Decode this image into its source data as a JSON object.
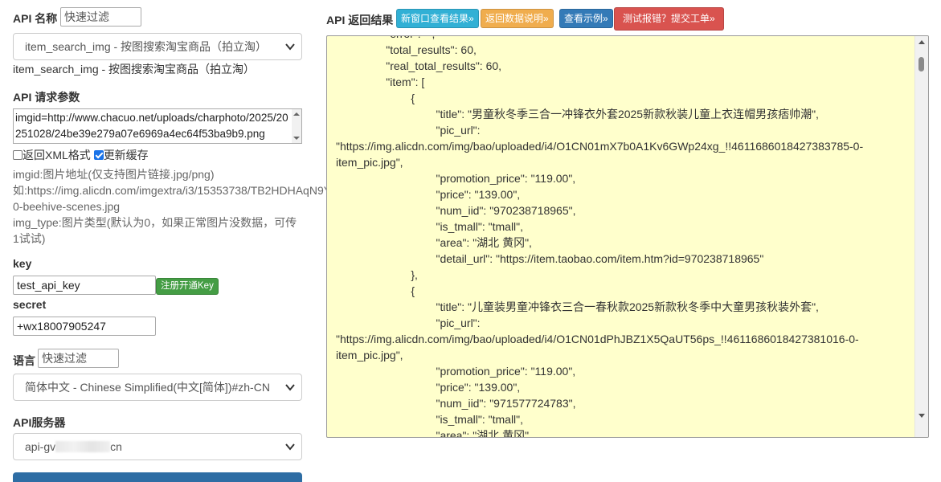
{
  "left": {
    "api_name_label": "API 名称",
    "api_filter_placeholder": "快速过滤",
    "api_select_value": "item_search_img - 按图搜索淘宝商品（拍立淘）",
    "api_desc": "item_search_img - 按图搜索淘宝商品（拍立淘）",
    "params_label": "API 请求参数",
    "params_value": "imgid=http://www.chacuo.net/uploads/charphoto/2025/20251028/24be39e279a07e6969a4ec64f53ba9b9.png",
    "xml_label": "返回XML格式",
    "cache_label": "更新缓存",
    "help_lines": [
      "imgid:图片地址(仅支持图片链接.jpg/png)",
      "如:https://img.alicdn.com/imgextra/i3/15353738/TB2HDHAqN9Y",
      "0-beehive-scenes.jpg",
      "img_type:图片类型(默认为0，如果正常图片没数据，可传",
      "1试试)"
    ],
    "key_label": "key",
    "key_value": "test_api_key",
    "register_key_label": "注册开通Key",
    "secret_label": "secret",
    "secret_value": "+wx18007905247",
    "lang_label": "语言",
    "lang_filter_placeholder": "快速过滤",
    "lang_select_value": "简体中文 - Chinese Simplified(中文[简体])#zh-CN",
    "server_label": "API服务器",
    "server_prefix": "api-gv",
    "server_suffix": "cn"
  },
  "right": {
    "result_label": "API 返回结果",
    "btn_new_window": "新窗口查看结果»",
    "btn_return_desc": "返回数据说明»",
    "btn_example": "查看示例»",
    "btn_report": "测试报错？提交工单»",
    "result_text": "                \"error\": \"\",\n                \"total_results\": 60,\n                \"real_total_results\": 60,\n                \"item\": [\n                        {\n                                \"title\": \"男童秋冬季三合一冲锋衣外套2025新款秋装儿童上衣连帽男孩痞帅潮\",\n                                \"pic_url\": \"https://img.alicdn.com/img/bao/uploaded/i4/O1CN01mX7b0A1Kv6GWp24xg_!!4611686018427383785-0-item_pic.jpg\",\n                                \"promotion_price\": \"119.00\",\n                                \"price\": \"139.00\",\n                                \"num_iid\": \"970238718965\",\n                                \"is_tmall\": \"tmall\",\n                                \"area\": \"湖北 黄冈\",\n                                \"detail_url\": \"https://item.taobao.com/item.htm?id=970238718965\"\n                        },\n                        {\n                                \"title\": \"儿童装男童冲锋衣三合一春秋款2025新款秋冬季中大童男孩秋装外套\",\n                                \"pic_url\": \"https://img.alicdn.com/img/bao/uploaded/i4/O1CN01dPhJBZ1X5QaUT56ps_!!4611686018427381016-0-item_pic.jpg\",\n                                \"promotion_price\": \"119.00\",\n                                \"price\": \"139.00\",\n                                \"num_iid\": \"971577724783\",\n                                \"is_tmall\": \"tmall\",\n                                \"area\": \"湖北 黄冈\","
  },
  "colors": {
    "btn_cyan": "#31b0d5",
    "btn_orange": "#f0ad4e",
    "btn_blue": "#337ab7",
    "btn_red": "#d9534f",
    "btn_green": "#449d44",
    "result_bg": "#ffffcc"
  }
}
